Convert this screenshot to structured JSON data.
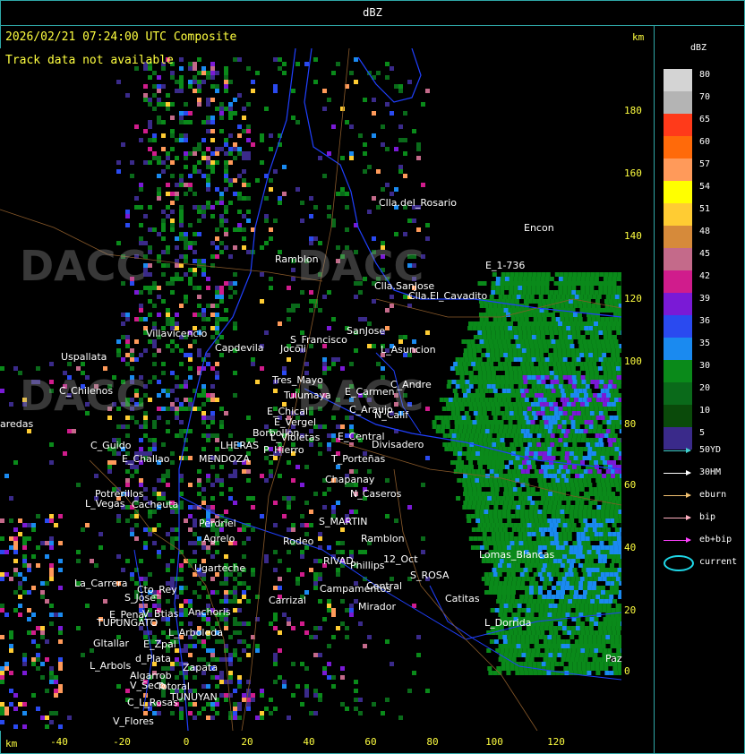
{
  "window": {
    "title": "dBZ"
  },
  "header": {
    "datetime": "2026/02/21 07:24:00 UTC Composite",
    "track_status": "Track data not available"
  },
  "axes": {
    "unit": "km",
    "y_ticks": [
      "180",
      "160",
      "140",
      "120",
      "100",
      "80",
      "60",
      "40",
      "20",
      "0"
    ],
    "x_ticks": [
      "-40",
      "-20",
      "0",
      "20",
      "40",
      "60",
      "80",
      "100",
      "120"
    ]
  },
  "legend": {
    "unit": "dBZ",
    "levels": [
      {
        "value": "80",
        "color": "#d4d4d4"
      },
      {
        "value": "70",
        "color": "#b4b4b4"
      },
      {
        "value": "65",
        "color": "#ff3a1a"
      },
      {
        "value": "60",
        "color": "#ff6a0a"
      },
      {
        "value": "57",
        "color": "#ff9a5a"
      },
      {
        "value": "54",
        "color": "#ffff00"
      },
      {
        "value": "51",
        "color": "#ffcc33"
      },
      {
        "value": "48",
        "color": "#d68a3a"
      },
      {
        "value": "45",
        "color": "#c46a8a"
      },
      {
        "value": "42",
        "color": "#d01c8c"
      },
      {
        "value": "39",
        "color": "#7a1ad6"
      },
      {
        "value": "36",
        "color": "#2a4af0"
      },
      {
        "value": "35",
        "color": "#1a8af0"
      },
      {
        "value": "30",
        "color": "#0a8a1a"
      },
      {
        "value": "20",
        "color": "#0a6a1a"
      },
      {
        "value": "10",
        "color": "#0a4a0a"
      },
      {
        "value": "5",
        "color": "#3a2a8a"
      }
    ],
    "tracks": [
      {
        "label": "50YD",
        "color": "#40d0d0"
      },
      {
        "label": "30HM",
        "color": "#ffffff"
      },
      {
        "label": "eburn",
        "color": "#f0c070"
      },
      {
        "label": "bip",
        "color": "#ffb0c0"
      },
      {
        "label": "eb+bip",
        "color": "#ff40ff"
      }
    ],
    "current_label": "current"
  },
  "places": [
    {
      "name": "Clla.del_Rosario"
    },
    {
      "name": "Encon"
    },
    {
      "name": "Ramblon"
    },
    {
      "name": "E_1-736"
    },
    {
      "name": "Clla.SanJose"
    },
    {
      "name": "Clla.El_Cavadito"
    },
    {
      "name": "Villavicencio"
    },
    {
      "name": "Capdevila"
    },
    {
      "name": "S_Francisco"
    },
    {
      "name": "SanJose"
    },
    {
      "name": "Jocoli"
    },
    {
      "name": "L_Asuncion"
    },
    {
      "name": "Uspallata"
    },
    {
      "name": "Tres_Mayo"
    },
    {
      "name": "C_Andre"
    },
    {
      "name": "C_Chilenos"
    },
    {
      "name": "Tulumaya"
    },
    {
      "name": "E_Carmen"
    },
    {
      "name": "E_Chical"
    },
    {
      "name": "C_Araujo"
    },
    {
      "name": "N_Calif"
    },
    {
      "name": "E_Vergel"
    },
    {
      "name": "aredas"
    },
    {
      "name": "Borbollon"
    },
    {
      "name": "E_Central"
    },
    {
      "name": "L_Violetas"
    },
    {
      "name": "C_Guido"
    },
    {
      "name": "LHERAS"
    },
    {
      "name": "P_Hierro"
    },
    {
      "name": "Divisadero"
    },
    {
      "name": "E_Challao"
    },
    {
      "name": "MENDOZA"
    },
    {
      "name": "T_Porteñas"
    },
    {
      "name": "Chapanay"
    },
    {
      "name": "Potrerillos"
    },
    {
      "name": "Cacheuta"
    },
    {
      "name": "L_Vegas"
    },
    {
      "name": "N_Caseros"
    },
    {
      "name": "Perdriel"
    },
    {
      "name": "S_MARTIN"
    },
    {
      "name": "Agrelo"
    },
    {
      "name": "Rodeo"
    },
    {
      "name": "Ramblon"
    },
    {
      "name": "Ugarteche"
    },
    {
      "name": "12_Oct"
    },
    {
      "name": "Phillips"
    },
    {
      "name": "S_ROSA"
    },
    {
      "name": "RIVAD"
    },
    {
      "name": "Lomas_Blancas"
    },
    {
      "name": "La_Carrera"
    },
    {
      "name": "Cto_Rey"
    },
    {
      "name": "S_Jose"
    },
    {
      "name": "Campamentos"
    },
    {
      "name": "Central"
    },
    {
      "name": "Catitas"
    },
    {
      "name": "Anchoris"
    },
    {
      "name": "V_Btias"
    },
    {
      "name": "Carrizal"
    },
    {
      "name": "Mirador"
    },
    {
      "name": "E_Pena"
    },
    {
      "name": "TUPUNGATO"
    },
    {
      "name": "L_Arboleda"
    },
    {
      "name": "L_Dorrida"
    },
    {
      "name": "Gltallar"
    },
    {
      "name": "E_Zpal"
    },
    {
      "name": "d_Plata"
    },
    {
      "name": "L_Arbols"
    },
    {
      "name": "Zapata"
    },
    {
      "name": "Algarrob"
    },
    {
      "name": "V_Seco"
    },
    {
      "name": "Totoral"
    },
    {
      "name": "TUNUYAN"
    },
    {
      "name": "C_L_Rosas"
    },
    {
      "name": "V_Flores"
    },
    {
      "name": "Paz"
    }
  ],
  "watermarks": [
    {
      "text": "DACC"
    },
    {
      "text": "DACC"
    },
    {
      "text": "DACC"
    },
    {
      "text": "DACC"
    }
  ]
}
